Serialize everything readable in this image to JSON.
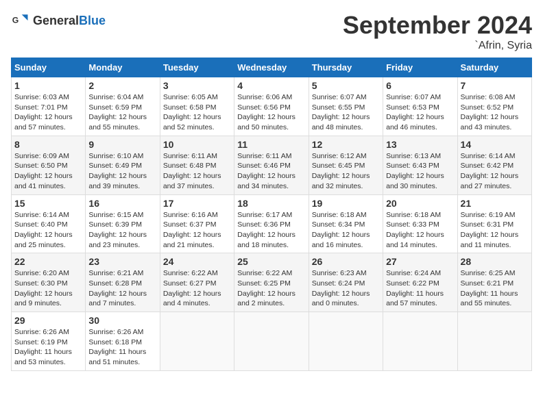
{
  "header": {
    "logo_general": "General",
    "logo_blue": "Blue",
    "month_title": "September 2024",
    "location": "`Afrin, Syria"
  },
  "weekdays": [
    "Sunday",
    "Monday",
    "Tuesday",
    "Wednesday",
    "Thursday",
    "Friday",
    "Saturday"
  ],
  "weeks": [
    [
      {
        "day": "1",
        "sunrise": "6:03 AM",
        "sunset": "7:01 PM",
        "daylight": "12 hours and 57 minutes."
      },
      {
        "day": "2",
        "sunrise": "6:04 AM",
        "sunset": "6:59 PM",
        "daylight": "12 hours and 55 minutes."
      },
      {
        "day": "3",
        "sunrise": "6:05 AM",
        "sunset": "6:58 PM",
        "daylight": "12 hours and 52 minutes."
      },
      {
        "day": "4",
        "sunrise": "6:06 AM",
        "sunset": "6:56 PM",
        "daylight": "12 hours and 50 minutes."
      },
      {
        "day": "5",
        "sunrise": "6:07 AM",
        "sunset": "6:55 PM",
        "daylight": "12 hours and 48 minutes."
      },
      {
        "day": "6",
        "sunrise": "6:07 AM",
        "sunset": "6:53 PM",
        "daylight": "12 hours and 46 minutes."
      },
      {
        "day": "7",
        "sunrise": "6:08 AM",
        "sunset": "6:52 PM",
        "daylight": "12 hours and 43 minutes."
      }
    ],
    [
      {
        "day": "8",
        "sunrise": "6:09 AM",
        "sunset": "6:50 PM",
        "daylight": "12 hours and 41 minutes."
      },
      {
        "day": "9",
        "sunrise": "6:10 AM",
        "sunset": "6:49 PM",
        "daylight": "12 hours and 39 minutes."
      },
      {
        "day": "10",
        "sunrise": "6:11 AM",
        "sunset": "6:48 PM",
        "daylight": "12 hours and 37 minutes."
      },
      {
        "day": "11",
        "sunrise": "6:11 AM",
        "sunset": "6:46 PM",
        "daylight": "12 hours and 34 minutes."
      },
      {
        "day": "12",
        "sunrise": "6:12 AM",
        "sunset": "6:45 PM",
        "daylight": "12 hours and 32 minutes."
      },
      {
        "day": "13",
        "sunrise": "6:13 AM",
        "sunset": "6:43 PM",
        "daylight": "12 hours and 30 minutes."
      },
      {
        "day": "14",
        "sunrise": "6:14 AM",
        "sunset": "6:42 PM",
        "daylight": "12 hours and 27 minutes."
      }
    ],
    [
      {
        "day": "15",
        "sunrise": "6:14 AM",
        "sunset": "6:40 PM",
        "daylight": "12 hours and 25 minutes."
      },
      {
        "day": "16",
        "sunrise": "6:15 AM",
        "sunset": "6:39 PM",
        "daylight": "12 hours and 23 minutes."
      },
      {
        "day": "17",
        "sunrise": "6:16 AM",
        "sunset": "6:37 PM",
        "daylight": "12 hours and 21 minutes."
      },
      {
        "day": "18",
        "sunrise": "6:17 AM",
        "sunset": "6:36 PM",
        "daylight": "12 hours and 18 minutes."
      },
      {
        "day": "19",
        "sunrise": "6:18 AM",
        "sunset": "6:34 PM",
        "daylight": "12 hours and 16 minutes."
      },
      {
        "day": "20",
        "sunrise": "6:18 AM",
        "sunset": "6:33 PM",
        "daylight": "12 hours and 14 minutes."
      },
      {
        "day": "21",
        "sunrise": "6:19 AM",
        "sunset": "6:31 PM",
        "daylight": "12 hours and 11 minutes."
      }
    ],
    [
      {
        "day": "22",
        "sunrise": "6:20 AM",
        "sunset": "6:30 PM",
        "daylight": "12 hours and 9 minutes."
      },
      {
        "day": "23",
        "sunrise": "6:21 AM",
        "sunset": "6:28 PM",
        "daylight": "12 hours and 7 minutes."
      },
      {
        "day": "24",
        "sunrise": "6:22 AM",
        "sunset": "6:27 PM",
        "daylight": "12 hours and 4 minutes."
      },
      {
        "day": "25",
        "sunrise": "6:22 AM",
        "sunset": "6:25 PM",
        "daylight": "12 hours and 2 minutes."
      },
      {
        "day": "26",
        "sunrise": "6:23 AM",
        "sunset": "6:24 PM",
        "daylight": "12 hours and 0 minutes."
      },
      {
        "day": "27",
        "sunrise": "6:24 AM",
        "sunset": "6:22 PM",
        "daylight": "11 hours and 57 minutes."
      },
      {
        "day": "28",
        "sunrise": "6:25 AM",
        "sunset": "6:21 PM",
        "daylight": "11 hours and 55 minutes."
      }
    ],
    [
      {
        "day": "29",
        "sunrise": "6:26 AM",
        "sunset": "6:19 PM",
        "daylight": "11 hours and 53 minutes."
      },
      {
        "day": "30",
        "sunrise": "6:26 AM",
        "sunset": "6:18 PM",
        "daylight": "11 hours and 51 minutes."
      },
      null,
      null,
      null,
      null,
      null
    ]
  ]
}
